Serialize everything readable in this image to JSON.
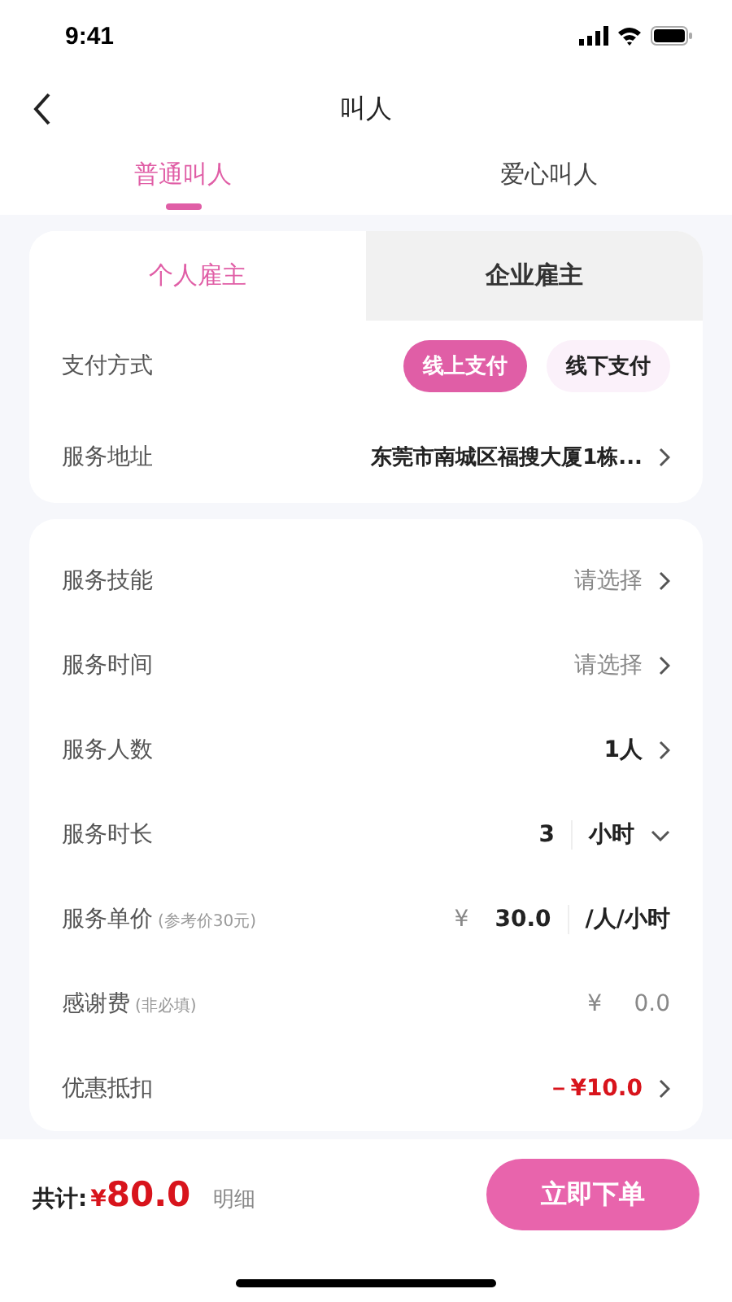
{
  "status_bar": {
    "time": "9:41"
  },
  "nav": {
    "title": "叫人"
  },
  "tabs": [
    {
      "label": "普通叫人",
      "selected": true
    },
    {
      "label": "爱心叫人",
      "selected": false
    }
  ],
  "employer_tabs": [
    {
      "label": "个人雇主",
      "selected": true
    },
    {
      "label": "企业雇主",
      "selected": false
    }
  ],
  "payment": {
    "label": "支付方式",
    "options": [
      {
        "label": "线上支付",
        "selected": true
      },
      {
        "label": "线下支付",
        "selected": false
      }
    ]
  },
  "address": {
    "label": "服务地址",
    "value": "东莞市南城区福搜大厦1栋..."
  },
  "rows": [
    {
      "kind": "picker",
      "label": "服务技能",
      "placeholder": "请选择"
    },
    {
      "kind": "picker",
      "label": "服务时间",
      "placeholder": "请选择"
    },
    {
      "kind": "picker",
      "label": "服务人数",
      "value": "1人"
    },
    {
      "kind": "duration",
      "label": "服务时长",
      "amount": "3",
      "unit": "小时"
    },
    {
      "kind": "price",
      "label": "服务单价",
      "note": "(参考价30元)",
      "currency": "¥",
      "amount": "30.0",
      "unit": "/人/小时"
    },
    {
      "kind": "tip",
      "label": "感谢费",
      "note": "(非必填)",
      "currency": "¥",
      "placeholder": "0.0"
    },
    {
      "kind": "discount",
      "label": "优惠抵扣",
      "value": "－¥10.0"
    }
  ],
  "footer": {
    "total_label": "共计:",
    "currency": "¥",
    "total": "80.0",
    "details": "明细",
    "submit": "立即下单"
  }
}
